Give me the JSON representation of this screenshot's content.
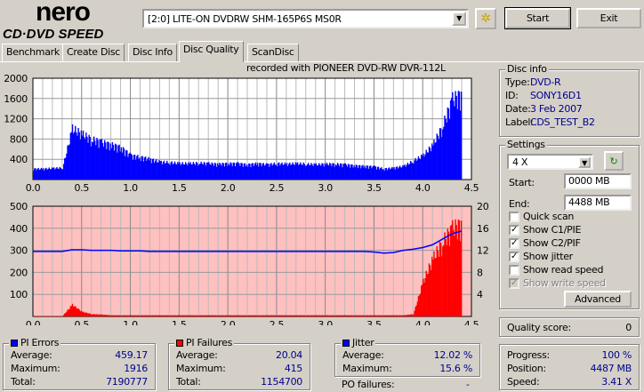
{
  "app": {
    "logo_top": "nero",
    "logo_bottom": "CD·DVD SPEED"
  },
  "toolbar": {
    "drive": "[2:0]  LITE-ON DVDRW SHM-165P6S MS0R",
    "start_label": "Start",
    "exit_label": "Exit",
    "settings_icon": "gear-chip-icon"
  },
  "tabs": [
    {
      "label": "Benchmark"
    },
    {
      "label": "Create Disc"
    },
    {
      "label": "Disc Info"
    },
    {
      "label": "Disc Quality",
      "active": true
    },
    {
      "label": "ScanDisc"
    }
  ],
  "recorded_with": "recorded with PIONEER  DVD-RW  DVR-112L",
  "disc_info": {
    "title": "Disc info",
    "type_label": "Type:",
    "type": "DVD-R",
    "id_label": "ID:",
    "id": "SONY16D1",
    "date_label": "Date:",
    "date": "3 Feb 2007",
    "label_label": "Label:",
    "label": "CDS_TEST_B2"
  },
  "settings": {
    "title": "Settings",
    "speed": "4 X",
    "start_label": "Start:",
    "start": "0000 MB",
    "end_label": "End:",
    "end": "4488 MB",
    "options": [
      {
        "label": "Quick scan",
        "checked": false,
        "disabled": false
      },
      {
        "label": "Show C1/PIE",
        "checked": true,
        "disabled": false
      },
      {
        "label": "Show C2/PIF",
        "checked": true,
        "disabled": false
      },
      {
        "label": "Show jitter",
        "checked": true,
        "disabled": false
      },
      {
        "label": "Show read speed",
        "checked": false,
        "disabled": false
      },
      {
        "label": "Show write speed",
        "checked": true,
        "disabled": true
      }
    ],
    "advanced_label": "Advanced"
  },
  "quality": {
    "label": "Quality score:",
    "value": "0"
  },
  "pi_errors": {
    "title": "PI Errors",
    "color": "#0000ff",
    "average_label": "Average:",
    "average": "459.17",
    "maximum_label": "Maximum:",
    "maximum": "1916",
    "total_label": "Total:",
    "total": "7190777"
  },
  "pi_failures": {
    "title": "PI Failures",
    "color": "#ff0000",
    "average_label": "Average:",
    "average": "20.04",
    "maximum_label": "Maximum:",
    "maximum": "415",
    "total_label": "Total:",
    "total": "1154700"
  },
  "jitter": {
    "title": "Jitter",
    "color": "#0000ff",
    "average_label": "Average:",
    "average": "12.02 %",
    "maximum_label": "Maximum:",
    "maximum": "15.6 %",
    "po_label": "PO failures:",
    "po": "-"
  },
  "progress": {
    "progress_label": "Progress:",
    "progress": "100 %",
    "position_label": "Position:",
    "position": "4487 MB",
    "speed_label": "Speed:",
    "speed": "3.41 X"
  },
  "chart_data": [
    {
      "type": "bar",
      "series": [
        {
          "name": "PI Errors",
          "color": "#0000ff"
        }
      ],
      "xlim": [
        0,
        4.5
      ],
      "ylim": [
        0,
        2000
      ],
      "xticks": [
        "0.0",
        "0.5",
        "1.0",
        "1.5",
        "2.0",
        "2.5",
        "3.0",
        "3.5",
        "4.0",
        "4.5"
      ],
      "yticks": [
        "400",
        "800",
        "1200",
        "1600",
        "2000"
      ],
      "grid": true,
      "x": [
        0,
        0.1,
        0.2,
        0.3,
        0.4,
        0.5,
        0.6,
        0.7,
        0.8,
        0.9,
        1.0,
        1.1,
        1.2,
        1.3,
        1.4,
        1.5,
        1.6,
        1.7,
        1.8,
        1.9,
        2.0,
        2.1,
        2.2,
        2.3,
        2.4,
        2.5,
        2.6,
        2.7,
        2.8,
        2.9,
        3.0,
        3.1,
        3.2,
        3.3,
        3.4,
        3.5,
        3.6,
        3.7,
        3.8,
        3.9,
        4.0,
        4.1,
        4.2,
        4.3,
        4.4
      ],
      "values": [
        200,
        200,
        210,
        220,
        950,
        850,
        750,
        700,
        650,
        600,
        450,
        420,
        380,
        330,
        320,
        300,
        300,
        310,
        300,
        290,
        300,
        300,
        280,
        300,
        280,
        300,
        290,
        300,
        290,
        280,
        290,
        290,
        280,
        260,
        250,
        240,
        200,
        220,
        250,
        350,
        450,
        650,
        1000,
        1500,
        1600
      ]
    },
    {
      "type": "bar+line",
      "xlim": [
        0,
        4.5
      ],
      "ylim": [
        0,
        500
      ],
      "y2lim": [
        0,
        20
      ],
      "xticks": [
        "0.0",
        "0.5",
        "1.0",
        "1.5",
        "2.0",
        "2.5",
        "3.0",
        "3.5",
        "4.0",
        "4.5"
      ],
      "yticks": [
        "100",
        "200",
        "300",
        "400",
        "500"
      ],
      "y2ticks": [
        "4",
        "8",
        "12",
        "16",
        "20"
      ],
      "grid": true,
      "series": [
        {
          "name": "PI Failures",
          "color": "#ff0000",
          "axis": "left",
          "values": [
            2,
            2,
            2,
            2,
            50,
            20,
            10,
            8,
            5,
            5,
            5,
            5,
            5,
            5,
            5,
            5,
            5,
            5,
            5,
            5,
            5,
            5,
            5,
            5,
            5,
            5,
            5,
            5,
            5,
            5,
            5,
            5,
            5,
            5,
            5,
            5,
            5,
            5,
            5,
            10,
            150,
            250,
            320,
            380,
            400
          ]
        },
        {
          "name": "Jitter",
          "color": "#0000ff",
          "axis": "right",
          "values": [
            11.8,
            11.8,
            11.8,
            11.8,
            12.1,
            12.1,
            12.0,
            12.0,
            12.0,
            11.9,
            11.9,
            11.9,
            11.8,
            11.8,
            11.8,
            11.8,
            11.8,
            11.8,
            11.8,
            11.8,
            11.8,
            11.8,
            11.8,
            11.8,
            11.8,
            11.8,
            11.8,
            11.8,
            11.8,
            11.8,
            11.8,
            11.8,
            11.8,
            11.8,
            11.8,
            11.7,
            11.5,
            11.6,
            12.0,
            12.2,
            12.5,
            13.0,
            14.0,
            15.0,
            15.5
          ]
        }
      ],
      "x": [
        0,
        0.1,
        0.2,
        0.3,
        0.4,
        0.5,
        0.6,
        0.7,
        0.8,
        0.9,
        1.0,
        1.1,
        1.2,
        1.3,
        1.4,
        1.5,
        1.6,
        1.7,
        1.8,
        1.9,
        2.0,
        2.1,
        2.2,
        2.3,
        2.4,
        2.5,
        2.6,
        2.7,
        2.8,
        2.9,
        3.0,
        3.1,
        3.2,
        3.3,
        3.4,
        3.5,
        3.6,
        3.7,
        3.8,
        3.9,
        4.0,
        4.1,
        4.2,
        4.3,
        4.4
      ]
    }
  ]
}
